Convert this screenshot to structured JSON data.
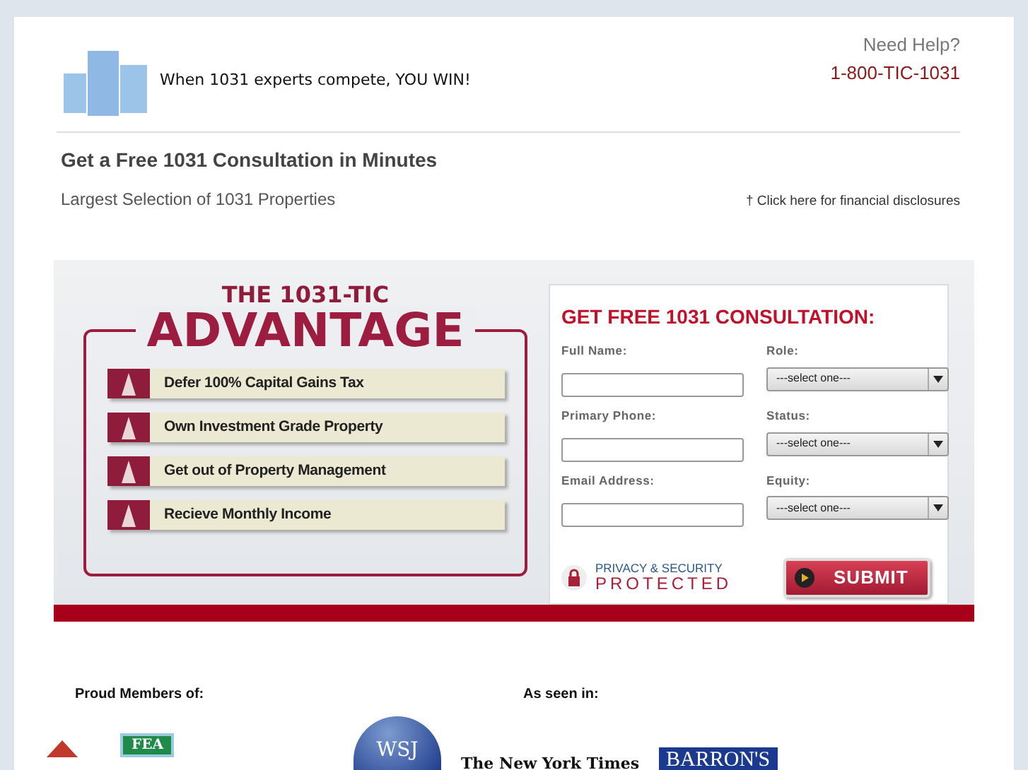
{
  "header": {
    "tagline": "When 1031 experts compete, YOU WIN!",
    "help_label": "Need Help?",
    "phone": "1-800-TIC-1031"
  },
  "intro": {
    "headline": "Get a Free 1031 Consultation in Minutes",
    "subheadline": "Largest Selection of 1031 Properties",
    "disclosure_link": "† Click here for financial disclosures"
  },
  "advantage": {
    "title_top": "THE 1031-TIC",
    "title_main": "ADVANTAGE",
    "items": [
      {
        "label": "Defer 100% Capital Gains Tax"
      },
      {
        "label": "Own Investment Grade Property"
      },
      {
        "label": "Get out of Property Management"
      },
      {
        "label": "Recieve Monthly Income"
      }
    ]
  },
  "form": {
    "title": "GET FREE 1031 CONSULTATION:",
    "fields": [
      {
        "label": "Full Name:",
        "kind": "text"
      },
      {
        "label": "Role:",
        "kind": "select",
        "value": "---select one---"
      },
      {
        "label": "Primary Phone:",
        "kind": "text"
      },
      {
        "label": "Status:",
        "kind": "select",
        "value": "---select one---"
      },
      {
        "label": "Email Address:",
        "kind": "text"
      },
      {
        "label": "Equity:",
        "kind": "select",
        "value": "---select one---"
      }
    ],
    "privacy_top": "PRIVACY & SECURITY",
    "privacy_bottom": "PROTECTED",
    "submit": "SUBMIT"
  },
  "footer": {
    "members_label": "Proud Members of:",
    "media_label": "As seen in:",
    "member_logos": [
      {
        "kind": "triangle"
      },
      {
        "kind": "badge",
        "text": "FEA"
      }
    ],
    "media_logos": [
      {
        "kind": "circle",
        "text": "WSJ"
      },
      {
        "kind": "script",
        "text": "The New York Times"
      },
      {
        "kind": "box",
        "text": "BARRON'S"
      }
    ]
  }
}
